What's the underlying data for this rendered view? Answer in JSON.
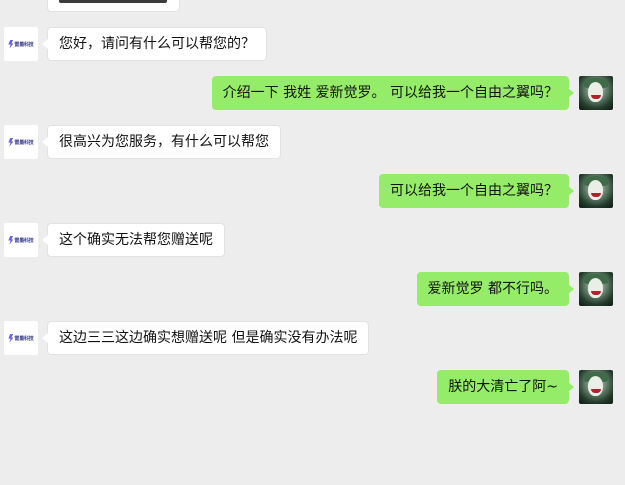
{
  "chat": {
    "bot_brand": "雷墨科技",
    "messages": [
      {
        "sender": "bot",
        "text": "您好，请问有什么可以帮您的？"
      },
      {
        "sender": "user",
        "text": "介绍一下 我姓 爱新觉罗。 可以给我一个自由之翼吗？"
      },
      {
        "sender": "bot",
        "text": "很高兴为您服务，有什么可以帮您"
      },
      {
        "sender": "user",
        "text": "可以给我一个自由之翼吗？"
      },
      {
        "sender": "bot",
        "text": "这个确实无法帮您赠送呢"
      },
      {
        "sender": "user",
        "text": "爱新觉罗 都不行吗。"
      },
      {
        "sender": "bot",
        "text": "这边三三这边确实想赠送呢  但是确实没有办法呢"
      },
      {
        "sender": "user",
        "text": "朕的大清亡了阿~"
      }
    ]
  },
  "colors": {
    "background": "#ededed",
    "user_bubble": "#95ec69",
    "bot_bubble": "#ffffff"
  }
}
